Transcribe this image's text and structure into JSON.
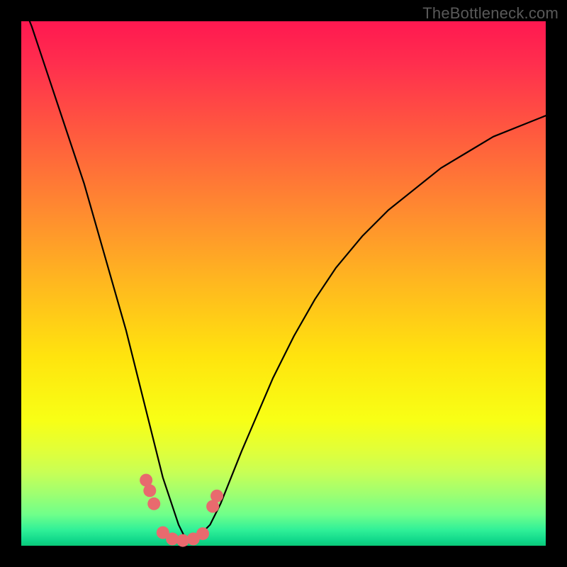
{
  "watermark": "TheBottleneck.com",
  "colors": {
    "frame": "#000000",
    "curve_stroke": "#000000",
    "marker_fill": "#e86a6e",
    "marker_stroke": "#c84a4e"
  },
  "chart_data": {
    "type": "line",
    "title": "",
    "xlabel": "",
    "ylabel": "",
    "xlim": [
      0,
      100
    ],
    "ylim": [
      0,
      100
    ],
    "grid": false,
    "legend": false,
    "series": [
      {
        "name": "bottleneck-curve",
        "x": [
          0,
          2,
          4,
          6,
          8,
          10,
          12,
          14,
          16,
          18,
          20,
          22,
          24,
          26,
          27,
          28,
          29,
          30,
          31,
          32,
          33,
          34,
          36,
          38,
          40,
          42,
          45,
          48,
          52,
          56,
          60,
          65,
          70,
          75,
          80,
          85,
          90,
          95,
          100
        ],
        "y": [
          104,
          99,
          93,
          87,
          81,
          75,
          69,
          62,
          55,
          48,
          41,
          33,
          25,
          17,
          13,
          10,
          7,
          4,
          2,
          1,
          1,
          2,
          4,
          8,
          13,
          18,
          25,
          32,
          40,
          47,
          53,
          59,
          64,
          68,
          72,
          75,
          78,
          80,
          82
        ]
      }
    ],
    "annotations": {
      "markers": [
        {
          "x": 23.8,
          "y": 12.5
        },
        {
          "x": 24.5,
          "y": 10.5
        },
        {
          "x": 25.3,
          "y": 8.0
        },
        {
          "x": 27.0,
          "y": 2.5
        },
        {
          "x": 28.8,
          "y": 1.3
        },
        {
          "x": 30.8,
          "y": 1.0
        },
        {
          "x": 32.8,
          "y": 1.3
        },
        {
          "x": 34.6,
          "y": 2.3
        },
        {
          "x": 36.5,
          "y": 7.5
        },
        {
          "x": 37.3,
          "y": 9.5
        }
      ]
    }
  }
}
